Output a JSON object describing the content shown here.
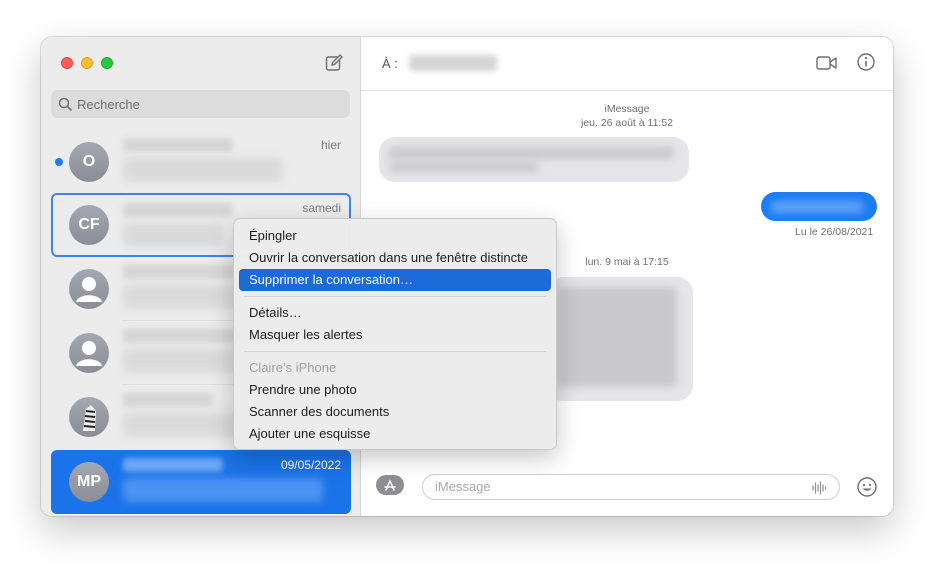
{
  "sidebar": {
    "search_placeholder": "Recherche",
    "conversations": [
      {
        "initials": "O",
        "time": "hier",
        "unread": true
      },
      {
        "initials": "CF",
        "time": "samedi",
        "unread": false
      },
      {
        "initials": "",
        "time": "",
        "unread": false
      },
      {
        "initials": "",
        "time": "",
        "unread": false
      },
      {
        "initials": "",
        "time": "",
        "unread": false
      },
      {
        "initials": "MP",
        "time": "09/05/2022",
        "unread": false
      }
    ]
  },
  "header": {
    "to_label": "À :"
  },
  "thread": {
    "service_label": "iMessage",
    "date_1": "jeu. 26 août à 11:52",
    "read_status": "Lu le 26/08/2021",
    "date_2": "lun. 9 mai à 17:15"
  },
  "composer": {
    "placeholder": "iMessage"
  },
  "context_menu": {
    "items": [
      "Épingler",
      "Ouvrir la conversation dans une fenêtre distincte",
      "Supprimer la conversation…",
      "Détails…",
      "Masquer les alertes",
      "Claire’s iPhone",
      "Prendre une photo",
      "Scanner des documents",
      "Ajouter une esquisse"
    ]
  },
  "colors": {
    "accent": "#1a6ad9",
    "bubble_out": "#1c7cf4",
    "bubble_in": "#e5e5ea",
    "selection": "#1a73e8"
  }
}
